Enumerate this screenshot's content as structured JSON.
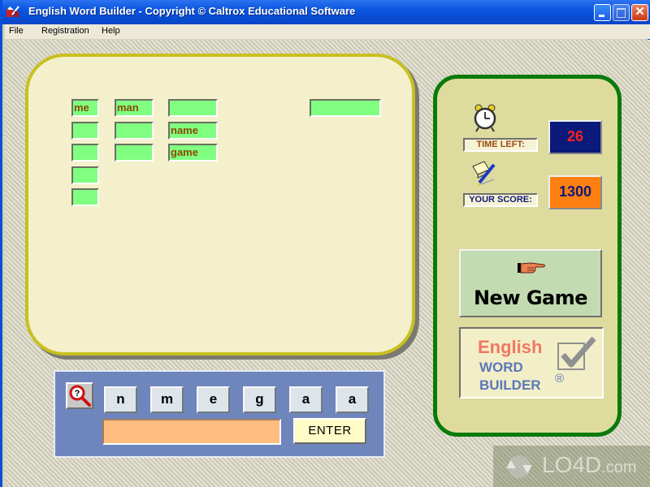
{
  "window": {
    "title": "English Word Builder -  Copyright © Caltrox Educational Software",
    "controls": {
      "minimize": "minimize",
      "maximize": "maximize",
      "close": "✕"
    }
  },
  "menu": {
    "items": [
      "File",
      "Registration",
      "Help"
    ]
  },
  "word_board": {
    "columns": [
      {
        "slots": [
          "me",
          "",
          "",
          "",
          ""
        ]
      },
      {
        "slots": [
          "man",
          "",
          ""
        ]
      },
      {
        "slots": [
          "",
          "name",
          "game"
        ]
      },
      {
        "slots": [
          ""
        ]
      }
    ]
  },
  "letters": {
    "hint_icon": "magnifier-question-icon",
    "tiles": [
      "n",
      "m",
      "e",
      "g",
      "a",
      "a"
    ],
    "answer_value": "",
    "enter_label": "ENTER"
  },
  "status": {
    "time_left_label": "TIME LEFT:",
    "time_left_value": "26",
    "score_label": "YOUR SCORE:",
    "score_value": "1300"
  },
  "actions": {
    "new_game_label": "New Game"
  },
  "logo": {
    "line1": "English",
    "line2": "WORD",
    "line3": "BUILDER",
    "registered": "®"
  },
  "watermark": {
    "text": "LO4D",
    "suffix": ".com"
  },
  "colors": {
    "slot_green": "#80ff80",
    "slot_text": "#8a4a00",
    "time_bg": "#0a1a7a",
    "time_fg": "#ff2020",
    "score_bg": "#ff8010",
    "score_fg": "#101878",
    "side_border": "#0a7a0a",
    "board_border": "#c8c020",
    "letter_panel": "#6e86bc"
  }
}
